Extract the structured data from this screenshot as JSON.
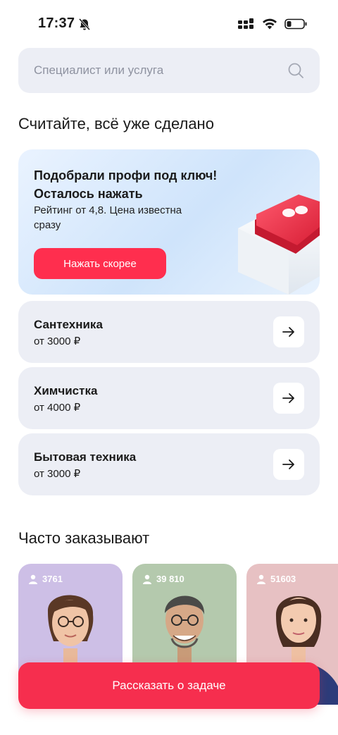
{
  "status_bar": {
    "time": "17:37",
    "icons": [
      "bell-slash-icon",
      "cellular-icon",
      "wifi-icon",
      "battery-icon"
    ]
  },
  "search": {
    "placeholder": "Специалист или услуга",
    "icon": "search-icon"
  },
  "ready_section": {
    "title": "Считайте, всё уже сделано"
  },
  "promo": {
    "title": "Подобрали профи под ключ! Осталось нажать",
    "text": "Рейтинг от 4,8. Цена известна сразу",
    "button_label": "Нажать скорее",
    "colors": {
      "button": "#ff2e4e",
      "key": "#e8283f"
    }
  },
  "categories": [
    {
      "name": "Сантехника",
      "price": "от 3000 ₽"
    },
    {
      "name": "Химчистка",
      "price": "от 4000 ₽"
    },
    {
      "name": "Бытовая техника",
      "price": "от 3000 ₽"
    }
  ],
  "popular_section": {
    "title": "Часто заказывают"
  },
  "specialists": [
    {
      "count": "3761",
      "bg": "#cdbfe6"
    },
    {
      "count": "39 810",
      "bg": "#b4c9ad"
    },
    {
      "count": "51603",
      "bg": "#e7c1c3"
    }
  ],
  "cta": {
    "label": "Рассказать о задаче",
    "color": "#f62e4e"
  }
}
